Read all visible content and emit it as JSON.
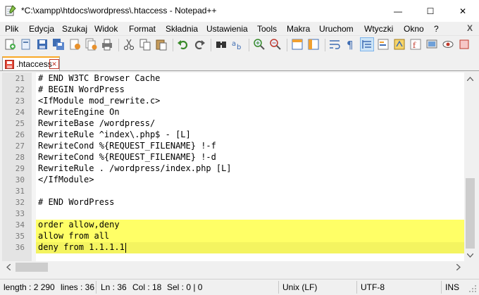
{
  "window": {
    "title": "*C:\\xampp\\htdocs\\wordpress\\.htaccess - Notepad++",
    "minimize": "—",
    "maximize": "☐",
    "close": "✕"
  },
  "menu": [
    "Plik",
    "Edycja",
    "Szukaj",
    "Widok",
    "Format",
    "Składnia",
    "Ustawienia",
    "Tools",
    "Makra",
    "Uruchom",
    "Wtyczki",
    "Okno",
    "?"
  ],
  "menu_close": "X",
  "tab": {
    "label": ".htaccess",
    "close": "✕"
  },
  "editor": {
    "lines": [
      {
        "num": "21",
        "text": "# END W3TC Browser Cache"
      },
      {
        "num": "22",
        "text": "# BEGIN WordPress"
      },
      {
        "num": "23",
        "text": "<IfModule mod_rewrite.c>"
      },
      {
        "num": "24",
        "text": "RewriteEngine On"
      },
      {
        "num": "25",
        "text": "RewriteBase /wordpress/"
      },
      {
        "num": "26",
        "text": "RewriteRule ^index\\.php$ - [L]"
      },
      {
        "num": "27",
        "text": "RewriteCond %{REQUEST_FILENAME} !-f"
      },
      {
        "num": "28",
        "text": "RewriteCond %{REQUEST_FILENAME} !-d"
      },
      {
        "num": "29",
        "text": "RewriteRule . /wordpress/index.php [L]"
      },
      {
        "num": "30",
        "text": "</IfModule>"
      },
      {
        "num": "31",
        "text": ""
      },
      {
        "num": "32",
        "text": "# END WordPress"
      },
      {
        "num": "33",
        "text": ""
      },
      {
        "num": "34",
        "text": "order allow,deny"
      },
      {
        "num": "35",
        "text": "allow from all"
      },
      {
        "num": "36",
        "text": "deny from 1.1.1.1"
      }
    ],
    "highlighted": [
      "34",
      "35",
      "36"
    ],
    "current_line": "36"
  },
  "status": {
    "length": "length : 2 290",
    "lines": "lines : 36",
    "ln": "Ln : 36",
    "col": "Col : 18",
    "sel": "Sel : 0 | 0",
    "eol": "Unix (LF)",
    "encoding": "UTF-8",
    "mode": "INS"
  },
  "colors": {
    "highlight": "#ffff66",
    "tab_accent": "#f9a825",
    "gutter": "#e4e4e4"
  }
}
